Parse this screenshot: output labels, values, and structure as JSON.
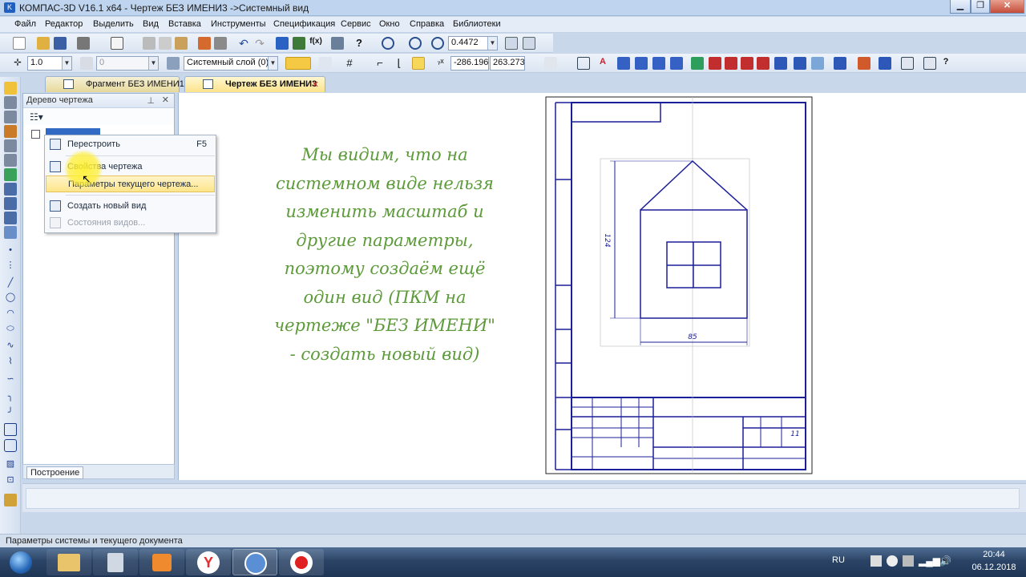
{
  "window": {
    "title": "КОМПАС-3D V16.1 x64 - Чертеж БЕЗ ИМЕНИ3 ->Системный вид",
    "app_icon": "kompas-icon",
    "controls": [
      "minimize-icon",
      "maximize-icon",
      "close-icon"
    ]
  },
  "menu": {
    "items": [
      "Файл",
      "Редактор",
      "Выделить",
      "Вид",
      "Вставка",
      "Инструменты",
      "Спецификация",
      "Сервис",
      "Окно",
      "Справка",
      "Библиотеки"
    ]
  },
  "toolbar": {
    "zoom_value": "0.4472",
    "line_scale": "1.0",
    "step_value": "0",
    "layer": "Системный слой (0)",
    "coord_x": "-286.196",
    "coord_y": "263.2739"
  },
  "tabs": [
    {
      "label": "Фрагмент БЕЗ ИМЕНИ1",
      "active": false
    },
    {
      "label": "Чертеж БЕЗ ИМЕНИ3",
      "active": true
    }
  ],
  "tree": {
    "title": "Дерево чертежа",
    "footer_tab": "Построение"
  },
  "context_menu": {
    "items": [
      {
        "label": "Перестроить",
        "shortcut": "F5",
        "icon": "rebuild-icon",
        "enabled": true
      },
      {
        "label": "Свойства чертежа",
        "shortcut": "",
        "icon": "properties-icon",
        "enabled": true
      },
      {
        "label": "Параметры текущего чертежа...",
        "shortcut": "",
        "icon": "",
        "enabled": true,
        "highlighted": true
      },
      {
        "label": "Создать новый вид",
        "shortcut": "",
        "icon": "new-view-icon",
        "enabled": true
      },
      {
        "label": "Состояния видов...",
        "shortcut": "",
        "icon": "view-states-icon",
        "enabled": false
      }
    ]
  },
  "caption": {
    "lines": [
      "Мы видим, что на",
      "системном виде нельзя",
      "изменить масштаб и",
      "другие параметры,",
      "поэтому создаём ещё",
      "один вид (ПКМ на",
      "чертеже \"БЕЗ ИМЕНИ\"",
      "- создать новый вид)"
    ],
    "color": "#5c9a3a"
  },
  "drawing": {
    "dim_width": "85",
    "dim_height": "124",
    "stamp_sheets": "11",
    "line_color": "#1b1f99"
  },
  "status_text": "Параметры системы и текущего документа",
  "taskbar": {
    "lang": "RU",
    "time": "20:44",
    "date": "06.12.2018"
  }
}
